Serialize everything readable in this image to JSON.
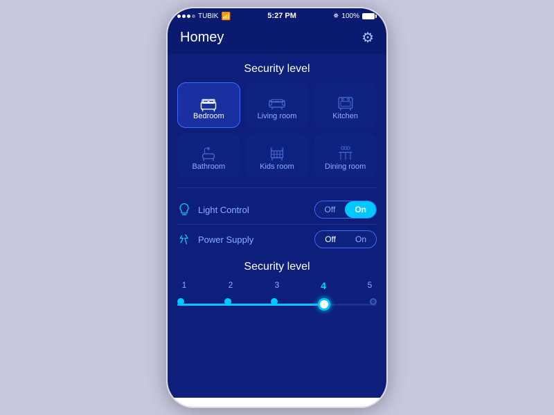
{
  "statusBar": {
    "carrier": "TUBIK",
    "time": "5:27 PM",
    "battery": "100%"
  },
  "header": {
    "title": "Homey"
  },
  "rooms": {
    "sectionTitle": "Security level",
    "items": [
      {
        "id": "bedroom",
        "label": "Bedroom",
        "icon": "bed",
        "active": true
      },
      {
        "id": "living-room",
        "label": "Living room",
        "icon": "sofa",
        "active": false
      },
      {
        "id": "kitchen",
        "label": "Kitchen",
        "icon": "stove",
        "active": false
      },
      {
        "id": "bathroom",
        "label": "Bathroom",
        "icon": "bath",
        "active": false
      },
      {
        "id": "kids-room",
        "label": "Kids room",
        "icon": "crib",
        "active": false
      },
      {
        "id": "dining-room",
        "label": "Dining room",
        "icon": "dining",
        "active": false
      }
    ]
  },
  "controls": [
    {
      "id": "light-control",
      "label": "Light Control",
      "icon": "bulb",
      "state": "on",
      "offLabel": "Off",
      "onLabel": "On"
    },
    {
      "id": "power-supply",
      "label": "Power Supply",
      "icon": "power",
      "state": "off",
      "offLabel": "Off",
      "onLabel": "On"
    }
  ],
  "security": {
    "sectionTitle": "Security level",
    "levels": [
      "1",
      "2",
      "3",
      "4",
      "5"
    ],
    "activeLevel": 4
  }
}
